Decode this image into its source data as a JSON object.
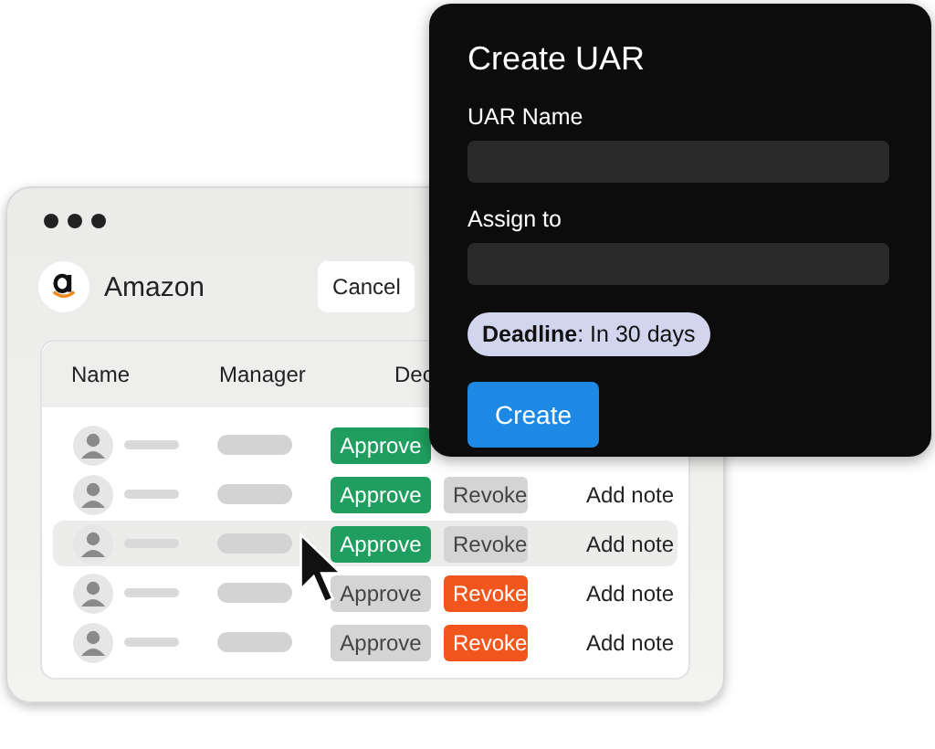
{
  "window": {
    "company": "Amazon",
    "cancel_button": "Cancel"
  },
  "table": {
    "columns": [
      "Name",
      "Manager",
      "Dec"
    ],
    "rows": [
      {
        "selected": false,
        "approved": true,
        "approve": "Approve"
      },
      {
        "selected": false,
        "approved": true,
        "revoked": false,
        "approve": "Approve",
        "revoke": "Revoke",
        "note": "Add note"
      },
      {
        "selected": true,
        "approved": true,
        "revoked": false,
        "approve": "Approve",
        "revoke": "Revoke",
        "note": "Add note"
      },
      {
        "selected": false,
        "approved": false,
        "revoked": true,
        "approve": "Approve",
        "revoke": "Revoke",
        "note": "Add note"
      },
      {
        "selected": false,
        "approved": false,
        "revoked": true,
        "approve": "Approve",
        "revoke": "Revoke",
        "note": "Add note"
      }
    ]
  },
  "dialog": {
    "title": "Create UAR",
    "fields": [
      {
        "label": "UAR Name"
      },
      {
        "label": "Assign to"
      }
    ],
    "deadline": "**Deadline**: In 30 days",
    "create_button": "Create"
  }
}
